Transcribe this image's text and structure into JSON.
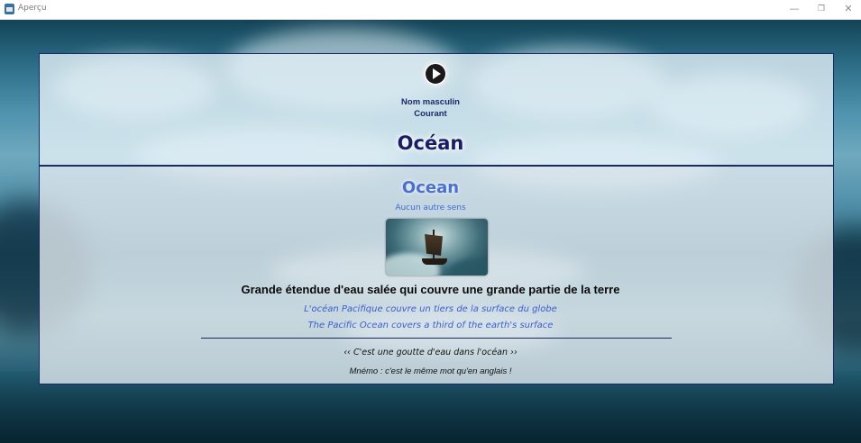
{
  "window": {
    "title": "Aperçu",
    "minimize_glyph": "—",
    "maximize_glyph": "❐",
    "close_glyph": "✕"
  },
  "entry": {
    "grammar_line1": "Nom masculin",
    "grammar_line2": "Courant",
    "word_fr": "Océan",
    "word_en": "Ocean",
    "other_sense": "Aucun autre sens",
    "definition": "Grande étendue d'eau salée qui couvre une grande partie de la terre",
    "example_fr": "L'océan Pacifique couvre un tiers de la surface du globe",
    "example_en": "The Pacific Ocean covers a third of the earth's surface",
    "saying": "‹‹ C'est une goutte d'eau dans l'océan ››",
    "mnemo": "Mnémo : c'est le même mot qu'en anglais !"
  },
  "icons": {
    "play": "play-icon",
    "app": "app-icon"
  },
  "colors": {
    "border": "#1b2a66",
    "word_fr": "#1a1c6a",
    "word_en": "#4a6fd6",
    "examples": "#3a5ed0"
  }
}
